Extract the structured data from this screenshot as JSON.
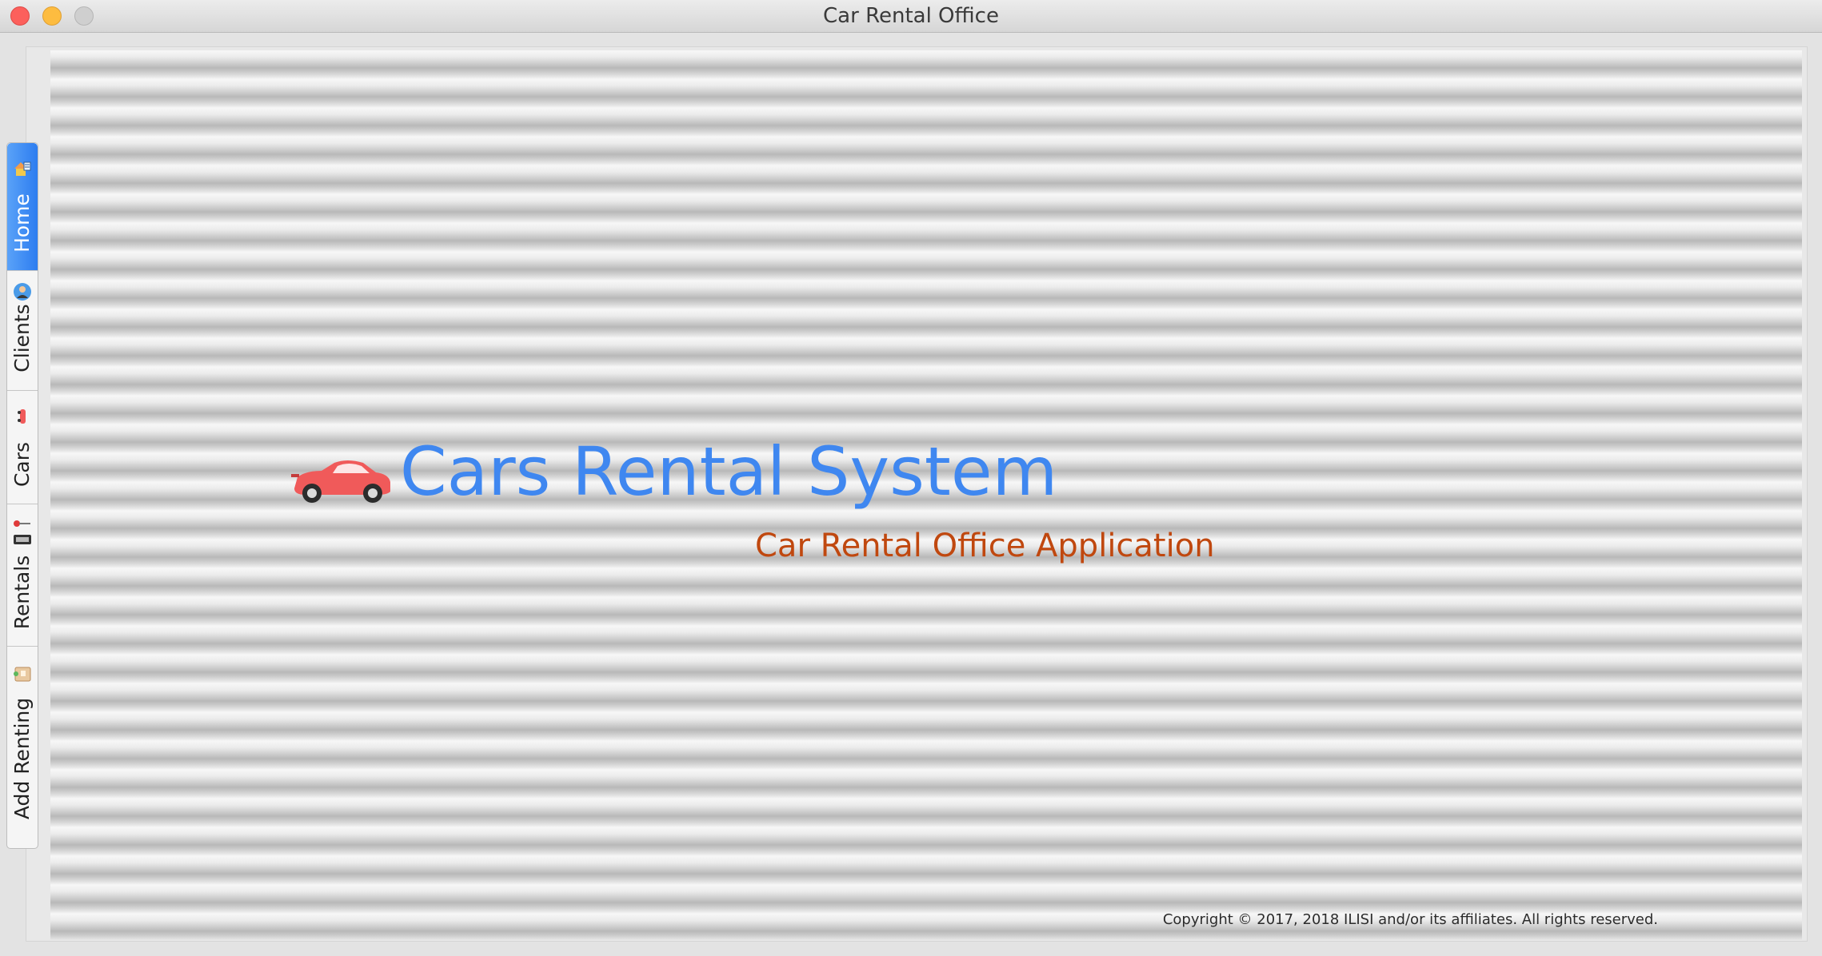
{
  "window": {
    "title": "Car Rental Office"
  },
  "tabs": [
    {
      "label": "Home",
      "icon": "home-icon",
      "selected": true
    },
    {
      "label": "Clients",
      "icon": "client-icon",
      "selected": false
    },
    {
      "label": "Cars",
      "icon": "car-icon",
      "selected": false
    },
    {
      "label": "Rentals",
      "icon": "rentals-icon",
      "selected": false
    },
    {
      "label": "Add Renting",
      "icon": "add-renting-icon",
      "selected": false
    }
  ],
  "home": {
    "headline": "Cars Rental System",
    "headline_icon": "sports-car-icon",
    "subtitle": "Car Rental Office Application",
    "copyright": "Copyright © 2017, 2018 ILISI and/or its affiliates. All rights reserved."
  },
  "colors": {
    "headline": "#3f87f0",
    "subtitle": "#c0480f",
    "active_tab": "#2d7df0",
    "car": "#f05a5a"
  }
}
